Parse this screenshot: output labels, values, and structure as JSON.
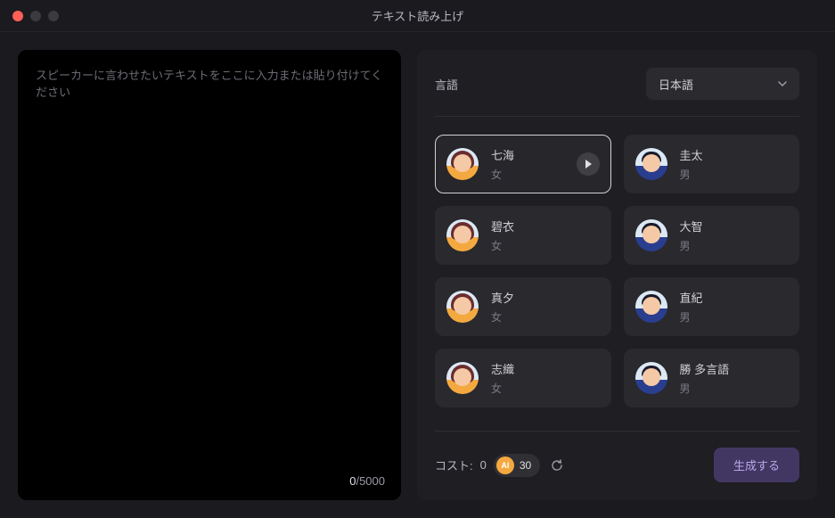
{
  "window": {
    "title": "テキスト読み上げ"
  },
  "input": {
    "placeholder": "スピーカーに言わせたいテキストをここに入力または貼り付けてください",
    "value": "",
    "count_current": "0",
    "count_separator": "/",
    "count_max": "5000"
  },
  "language": {
    "label": "言語",
    "selected": "日本語"
  },
  "speakers": [
    {
      "name": "七海",
      "gender": "女",
      "avatar_type": "female",
      "selected": true
    },
    {
      "name": "圭太",
      "gender": "男",
      "avatar_type": "male",
      "selected": false
    },
    {
      "name": "碧衣",
      "gender": "女",
      "avatar_type": "female",
      "selected": false
    },
    {
      "name": "大智",
      "gender": "男",
      "avatar_type": "male",
      "selected": false
    },
    {
      "name": "真夕",
      "gender": "女",
      "avatar_type": "female",
      "selected": false
    },
    {
      "name": "直紀",
      "gender": "男",
      "avatar_type": "male",
      "selected": false
    },
    {
      "name": "志織",
      "gender": "女",
      "avatar_type": "female",
      "selected": false
    },
    {
      "name": "勝 多言語",
      "gender": "男",
      "avatar_type": "male",
      "selected": false
    }
  ],
  "footer": {
    "cost_label": "コスト:",
    "cost_value": "0",
    "credit_icon_text": "AI",
    "credit_amount": "30",
    "generate_label": "生成する"
  }
}
